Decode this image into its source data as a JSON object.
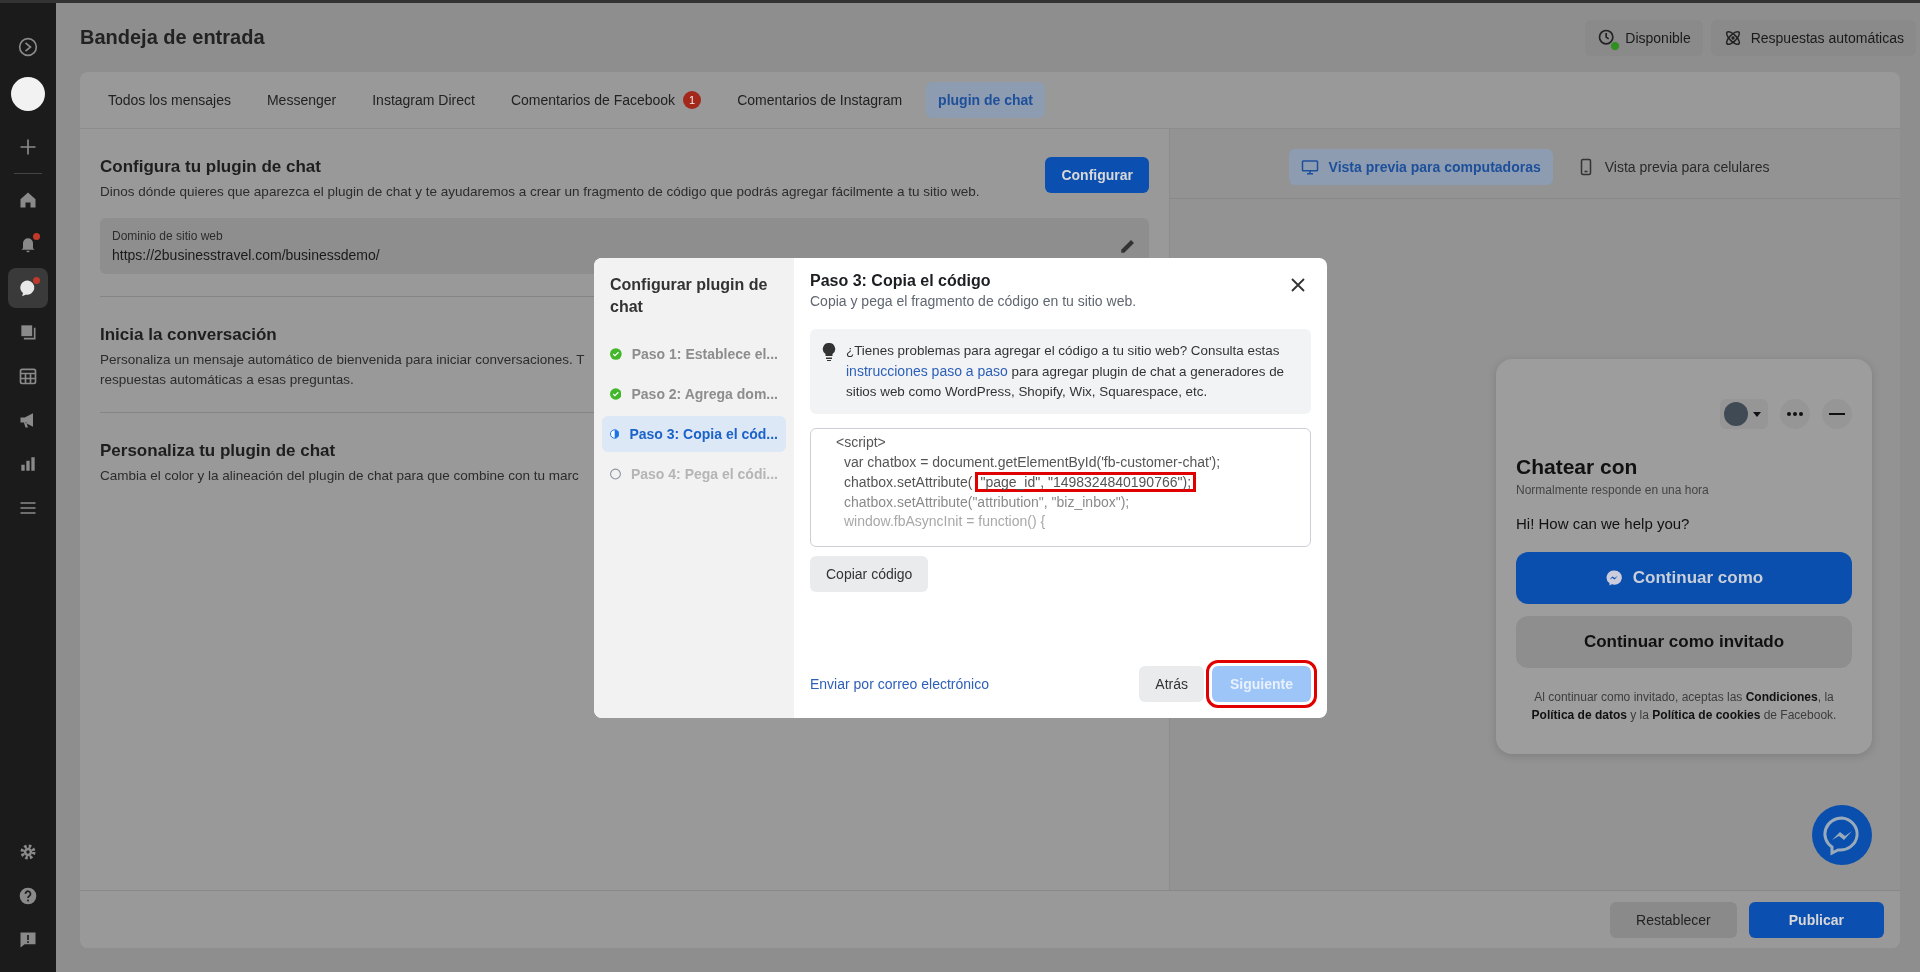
{
  "sidebar": {
    "top_actions": [
      {
        "kind": "logo"
      },
      {
        "kind": "avatar"
      },
      {
        "kind": "plus"
      }
    ],
    "items": [
      {
        "kind": "home",
        "selected": false,
        "badge": false
      },
      {
        "kind": "bell",
        "selected": false,
        "badge": true
      },
      {
        "kind": "chat",
        "selected": true,
        "badge": true
      },
      {
        "kind": "pages",
        "selected": false,
        "badge": false
      },
      {
        "kind": "calendar",
        "selected": false,
        "badge": false
      },
      {
        "kind": "megaphone",
        "selected": false,
        "badge": false
      },
      {
        "kind": "chart",
        "selected": false,
        "badge": false
      },
      {
        "kind": "menu",
        "selected": false,
        "badge": false
      }
    ],
    "bottom_items": [
      {
        "kind": "gear"
      },
      {
        "kind": "help"
      },
      {
        "kind": "feedback"
      }
    ]
  },
  "header": {
    "title": "Bandeja de entrada",
    "status_button": {
      "label": "Disponible",
      "online": true
    },
    "auto_reply_button": {
      "label": "Respuestas automáticas"
    }
  },
  "tabs": [
    {
      "label": "Todos los mensajes",
      "selected": false
    },
    {
      "label": "Messenger",
      "selected": false
    },
    {
      "label": "Instagram Direct",
      "selected": false
    },
    {
      "label": "Comentarios de Facebook",
      "selected": false,
      "count": "1"
    },
    {
      "label": "Comentarios de Instagram",
      "selected": false
    },
    {
      "label": "plugin de chat",
      "selected": true
    }
  ],
  "sections": [
    {
      "title": "Configura tu plugin de chat",
      "description": "Dinos dónde quieres que aparezca el plugin de chat y te ayudaremos a crear un fragmento de código que podrás agregar fácilmente a tu sitio web.",
      "button": "Configurar",
      "field": {
        "label": "Dominio de sitio web",
        "value": "https://2businesstravel.com/businessdemo/"
      }
    },
    {
      "title": "Inicia la conversación",
      "description_lines": [
        "Personaliza un mensaje automático de bienvenida para iniciar conversaciones. T",
        "respuestas automáticas a esas preguntas."
      ]
    },
    {
      "title": "Personaliza tu plugin de chat",
      "description": "Cambia el color y la alineación del plugin de chat para que combine con tu marc"
    }
  ],
  "preview": {
    "tabs": [
      {
        "label": "Vista previa para computadoras",
        "kind": "desktop",
        "selected": true
      },
      {
        "label": "Vista previa para celulares",
        "kind": "mobile",
        "selected": false
      }
    ],
    "widget": {
      "title": "Chatear con",
      "subtitle": "Normalmente responde en una hora",
      "greeting": "Hi! How can we help you?",
      "primary_button": "Continuar como",
      "secondary_button": "Continuar como invitado",
      "disclaimer": "Al continuar como invitado, aceptas las **Condiciones**, la **Política de datos** y la **Política de cookies** de Facebook."
    }
  },
  "footer": {
    "reset_button": "Restablecer",
    "publish_button": "Publicar"
  },
  "modal": {
    "sidebar_title": "Configurar plugin de chat",
    "steps": [
      {
        "label": "Paso 1: Establece el...",
        "kind": "done",
        "selected": false
      },
      {
        "label": "Paso 2: Agrega dom...",
        "kind": "done",
        "selected": false
      },
      {
        "label": "Paso 3: Copia el cód...",
        "kind": "current",
        "selected": true
      },
      {
        "label": "Paso 4: Pega el códi...",
        "kind": "todo",
        "selected": false
      }
    ],
    "title": "Paso 3: Copia el código",
    "subtitle": "Copia y pega el fragmento de código en tu sitio web.",
    "info_before": "¿Tienes problemas para agregar el código a tu sitio web? Consulta estas ",
    "info_link": "instrucciones paso a paso",
    "info_after": " para agregar plugin de chat a generadores de sitios web como WordPress, Shopify, Wix, Squarespace, etc.",
    "code_lines": [
      {
        "kind": "normal",
        "indent": false,
        "segments": [
          {
            "text": "<script>",
            "highlighted": false
          }
        ]
      },
      {
        "kind": "normal",
        "indent": true,
        "segments": [
          {
            "text": "var chatbox = document.getElementById('fb-customer-chat');",
            "highlighted": false
          }
        ]
      },
      {
        "kind": "normal",
        "indent": true,
        "segments": [
          {
            "text": "chatbox.setAttribute(",
            "highlighted": false
          },
          {
            "text": "\"page_id\", \"1498324840190766\");",
            "highlighted": true
          }
        ]
      },
      {
        "kind": "dim",
        "indent": true,
        "segments": [
          {
            "text": "chatbox.setAttribute(\"attribution\", \"biz_inbox\");",
            "highlighted": false
          }
        ]
      },
      {
        "kind": "faint",
        "indent": true,
        "segments": [
          {
            "text": "window.fbAsyncInit = function() {",
            "highlighted": false
          }
        ]
      }
    ],
    "copy_button": "Copiar código",
    "email_link": "Enviar por correo electrónico",
    "back_button": "Atrás",
    "next_button": {
      "label": "Siguiente",
      "disabled": true,
      "highlighted": true
    }
  }
}
